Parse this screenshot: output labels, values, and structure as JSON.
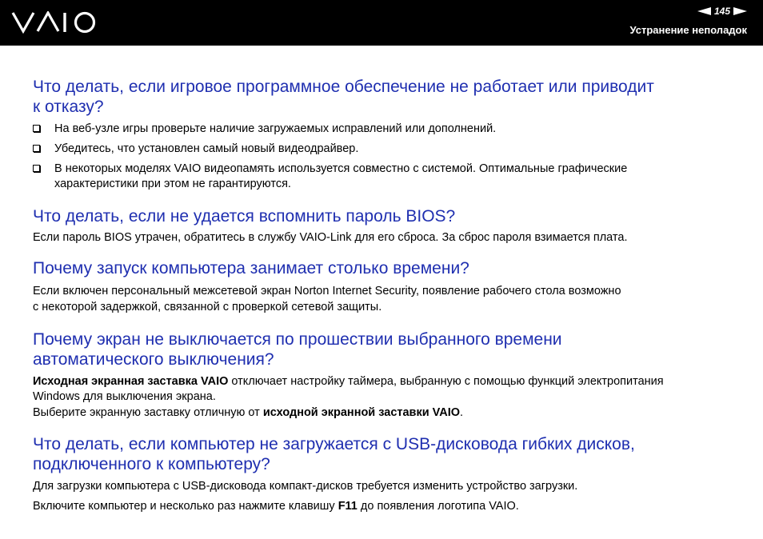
{
  "header": {
    "logo": "VAIO",
    "page_number": "145",
    "section": "Устранение неполадок"
  },
  "colors": {
    "heading": "#1f2fb0",
    "header_bg": "#000000"
  },
  "s1": {
    "title1": "Что делать, если игровое программное обеспечение не работает или приводит",
    "title2": "к отказу?",
    "bullets": [
      "На веб-узле игры проверьте наличие загружаемых исправлений или дополнений.",
      "Убедитесь, что установлен самый новый видеодрайвер.",
      "В некоторых моделях VAIO видеопамять используется совместно с системой. Оптимальные графические",
      "характеристики при этом не гарантируются."
    ]
  },
  "s2": {
    "title": "Что делать, если не удается вспомнить пароль BIOS?",
    "text": "Если пароль BIOS утрачен, обратитесь в службу VAIO-Link для его сброса. За сброс пароля взимается плата."
  },
  "s3": {
    "title": "Почему запуск компьютера занимает столько времени?",
    "line1": "Если включен персональный межсетевой экран Norton Internet Security, появление рабочего стола возможно",
    "line2": "с некоторой задержкой, связанной с проверкой сетевой защиты."
  },
  "s4": {
    "title1": "Почему экран не выключается по прошествии выбранного времени",
    "title2": "автоматического выключения?",
    "bold1": "Исходная экранная заставка VAIO",
    "rest1": " отключает настройку таймера, выбранную с помощью функций электропитания",
    "line2": "Windows для выключения экрана.",
    "line3a": "Выберите экранную заставку отличную от ",
    "line3b": "исходной экранной заставки VAIO",
    "line3c": "."
  },
  "s5": {
    "title1": "Что делать, если компьютер не загружается с USB-дисковода гибких дисков,",
    "title2": "подключенного к компьютеру?",
    "text1": "Для загрузки компьютера с USB-дисковода компакт-дисков требуется изменить устройство загрузки.",
    "text2a": "Включите компьютер и несколько раз нажмите клавишу ",
    "text2b": "F11",
    "text2c": " до появления логотипа VAIO."
  }
}
